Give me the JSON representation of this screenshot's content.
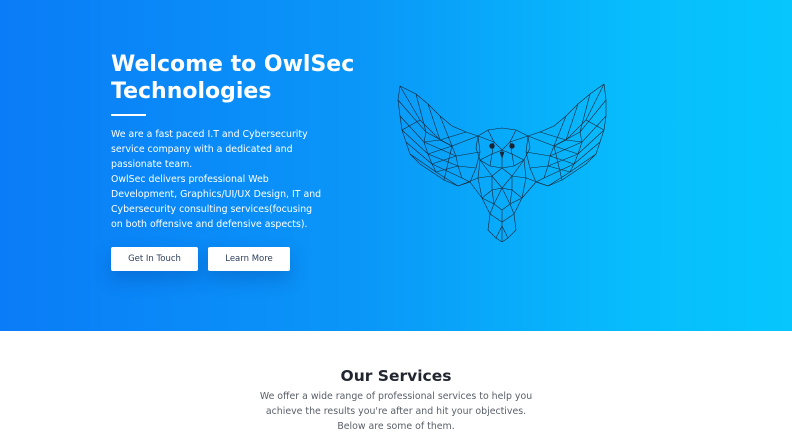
{
  "hero": {
    "title": "Welcome to OwlSec Technologies",
    "paragraph1": "We are a fast paced I.T and Cybersecurity service company with a dedicated and passionate team.",
    "paragraph2": "OwlSec delivers professional Web Development, Graphics/UI/UX Design, IT and Cybersecurity consulting services(focusing on both offensive and defensive aspects).",
    "buttons": {
      "get_in_touch": "Get In Touch",
      "learn_more": "Learn More"
    },
    "illustration": "owl-line-art-icon"
  },
  "services": {
    "title": "Our Services",
    "description": "We offer a wide range of professional services to help you achieve the results you're after and hit your objectives. Below are some of them."
  },
  "colors": {
    "hero_gradient_start": "#0a7cf7",
    "hero_gradient_end": "#06c6fd",
    "button_bg": "#ffffff",
    "button_text": "#2c3e5a",
    "heading_dark": "#222630",
    "body_gray": "#5a5f69"
  }
}
